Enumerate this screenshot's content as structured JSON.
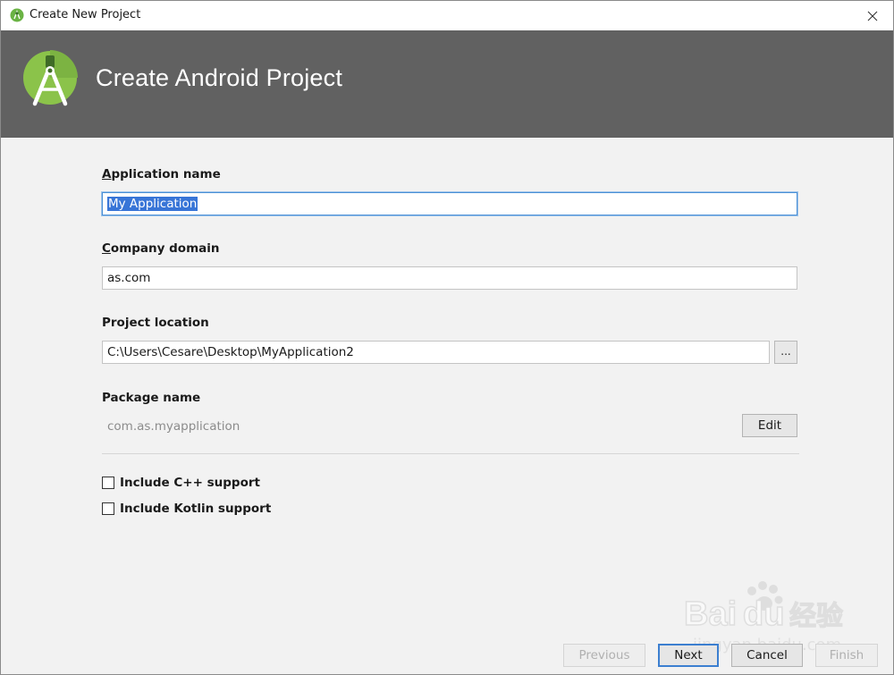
{
  "window": {
    "title": "Create New Project",
    "close_glyph": "✕"
  },
  "banner": {
    "heading": "Create Android Project",
    "logo_icon": "android-studio-logo-icon"
  },
  "form": {
    "app_name": {
      "label_first": "A",
      "label_rest": "pplication name",
      "value": "My Application"
    },
    "company_domain": {
      "label_first": "C",
      "label_rest": "ompany domain",
      "value": "as.com"
    },
    "project_location": {
      "label": "Project location",
      "value": "C:\\Users\\Cesare\\Desktop\\MyApplication2",
      "browse_label": "..."
    },
    "package_name": {
      "label": "Package name",
      "value": "com.as.myapplication",
      "edit_label": "Edit"
    },
    "cpp_support": {
      "label": "Include C++ support",
      "checked": false
    },
    "kotlin_support": {
      "label": "Include Kotlin support",
      "checked": false
    }
  },
  "footer": {
    "previous_label": "Previous",
    "next_label": "Next",
    "cancel_label": "Cancel",
    "finish_label": "Finish"
  },
  "watermark": {
    "brand": "Bai",
    "brand2": "du",
    "brand_cn": "经验",
    "url": "jingyan.baidu.com"
  },
  "colors": {
    "banner": "#616161",
    "accent": "#3c7fd0",
    "selection": "#3875d7",
    "android_green": "#8bc34a"
  }
}
